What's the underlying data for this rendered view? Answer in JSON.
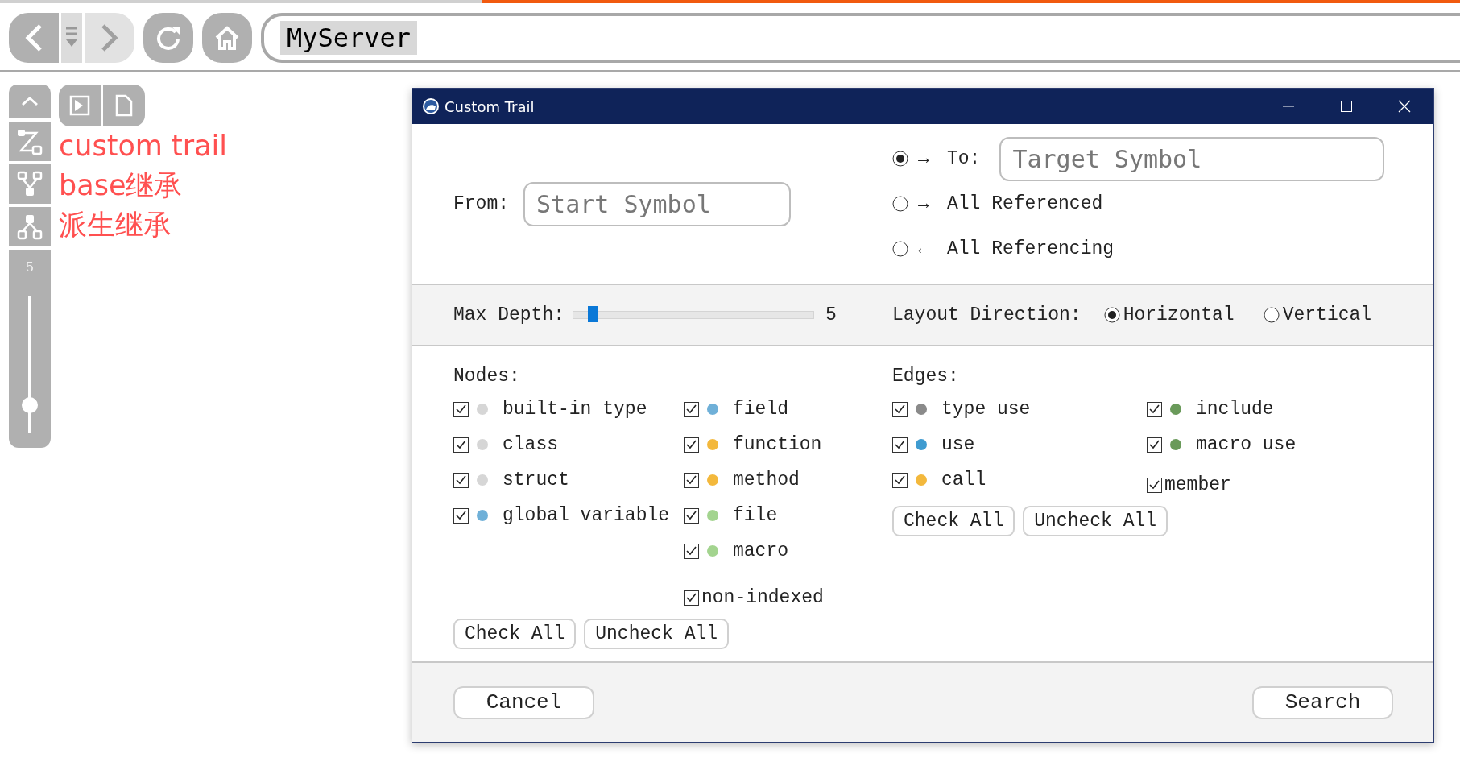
{
  "browser": {
    "address": "MyServer"
  },
  "rail": {
    "depth": "5",
    "level": 0.2
  },
  "annotations": [
    "custom trail",
    "base继承",
    "派生继承"
  ],
  "dialog": {
    "title": "Custom Trail",
    "from": {
      "label": "From:",
      "placeholder": "Start Symbol"
    },
    "targets": [
      {
        "kind": "field",
        "arrow": "→",
        "label": "To:",
        "selected": true,
        "placeholder": "Target Symbol"
      },
      {
        "kind": "plain",
        "arrow": "→",
        "label": "All Referenced",
        "selected": false
      },
      {
        "kind": "plain",
        "arrow": "←",
        "label": "All Referencing",
        "selected": false
      }
    ],
    "depth": {
      "label": "Max Depth:",
      "level": 0.08,
      "value": "5"
    },
    "layout": {
      "label": "Layout Direction:",
      "options": [
        {
          "label": "Horizontal",
          "selected": true
        },
        {
          "label": "Vertical",
          "selected": false
        }
      ]
    },
    "nodes": {
      "title": "Nodes:",
      "columns": [
        [
          {
            "kind": "dot",
            "label": "built-in type",
            "checked": true,
            "color": "#d6d6d6"
          },
          {
            "kind": "dot",
            "label": "class",
            "checked": true,
            "color": "#d6d6d6"
          },
          {
            "kind": "dot",
            "label": "struct",
            "checked": true,
            "color": "#d6d6d6"
          },
          {
            "kind": "dot",
            "label": "global variable",
            "checked": true,
            "color": "#6fb0d8"
          }
        ],
        [
          {
            "kind": "dot",
            "label": "field",
            "checked": true,
            "color": "#6fb0d8"
          },
          {
            "kind": "dot",
            "label": "function",
            "checked": true,
            "color": "#f3b83c"
          },
          {
            "kind": "dot",
            "label": "method",
            "checked": true,
            "color": "#f3b83c"
          },
          {
            "kind": "dot",
            "label": "file",
            "checked": true,
            "color": "#a3d48f"
          },
          {
            "kind": "dot",
            "label": "macro",
            "checked": true,
            "color": "#a3d48f"
          },
          {
            "kind": "plain",
            "label": "non-indexed",
            "checked": true
          }
        ]
      ],
      "buttons": [
        "Check All",
        "Uncheck All"
      ]
    },
    "edges": {
      "title": "Edges:",
      "columns": [
        [
          {
            "kind": "dot",
            "label": "type use",
            "checked": true,
            "color": "#8a8a8a"
          },
          {
            "kind": "dot",
            "label": "use",
            "checked": true,
            "color": "#3f9bd0"
          },
          {
            "kind": "dot",
            "label": "call",
            "checked": true,
            "color": "#f3b83c"
          }
        ],
        [
          {
            "kind": "dot",
            "label": "include",
            "checked": true,
            "color": "#6a9a5a"
          },
          {
            "kind": "dot",
            "label": "macro use",
            "checked": true,
            "color": "#6a9a5a"
          },
          {
            "kind": "plain",
            "label": "member",
            "checked": true
          }
        ]
      ],
      "buttons": [
        "Check All",
        "Uncheck All"
      ]
    },
    "buttons": [
      "Cancel",
      "Search"
    ]
  }
}
